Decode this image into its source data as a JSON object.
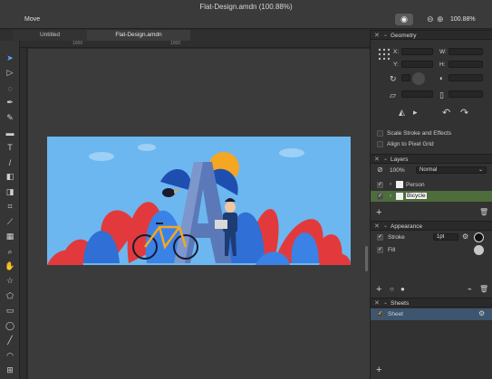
{
  "window": {
    "title": "Flat-Design.amdn (100.88%)",
    "tool_label": "Move",
    "zoom": "100.88%"
  },
  "icons": {
    "view": "eye-icon",
    "zoom_out": "zoom-out-icon",
    "zoom_in": "zoom-in-icon"
  },
  "tabs": [
    {
      "label": "Untitled"
    },
    {
      "label": "Flat-Design.amdn"
    }
  ],
  "ruler": {
    "top_labels": [
      "1000",
      "1000"
    ]
  },
  "tools": [
    "arrow",
    "direct-select",
    "lasso",
    "pen",
    "pencil",
    "brush",
    "text",
    "knife",
    "eraser",
    "shape-builder",
    "crop",
    "eyedropper",
    "gradient",
    "zoom",
    "hand",
    "star",
    "polygon",
    "rectangle",
    "ellipse",
    "line",
    "spiral",
    "artboard"
  ],
  "geometry": {
    "title": "Geometry",
    "x_label": "X:",
    "y_label": "Y:",
    "w_label": "W:",
    "h_label": "H:",
    "scale_stroke": "Scale Stroke and Effects",
    "align_pixel": "Align to Pixel Grid"
  },
  "layers": {
    "title": "Layers",
    "opacity": "100%",
    "blend": "Normal",
    "items": [
      {
        "name": "Person"
      },
      {
        "name": "Bicycle"
      }
    ]
  },
  "appearance": {
    "title": "Appearance",
    "stroke_label": "Stroke",
    "stroke_width": "1pt",
    "fill_label": "Fill"
  },
  "sheets": {
    "title": "Sheets",
    "items": [
      {
        "name": "Sheet"
      }
    ]
  },
  "colors": {
    "canvas_bg": "#3b3b3b",
    "artboard_sky": "#6cb7f0",
    "accent_red": "#e23a3c",
    "layer_selected": "#4d6d3c",
    "sheet_selected": "#3d556e"
  }
}
